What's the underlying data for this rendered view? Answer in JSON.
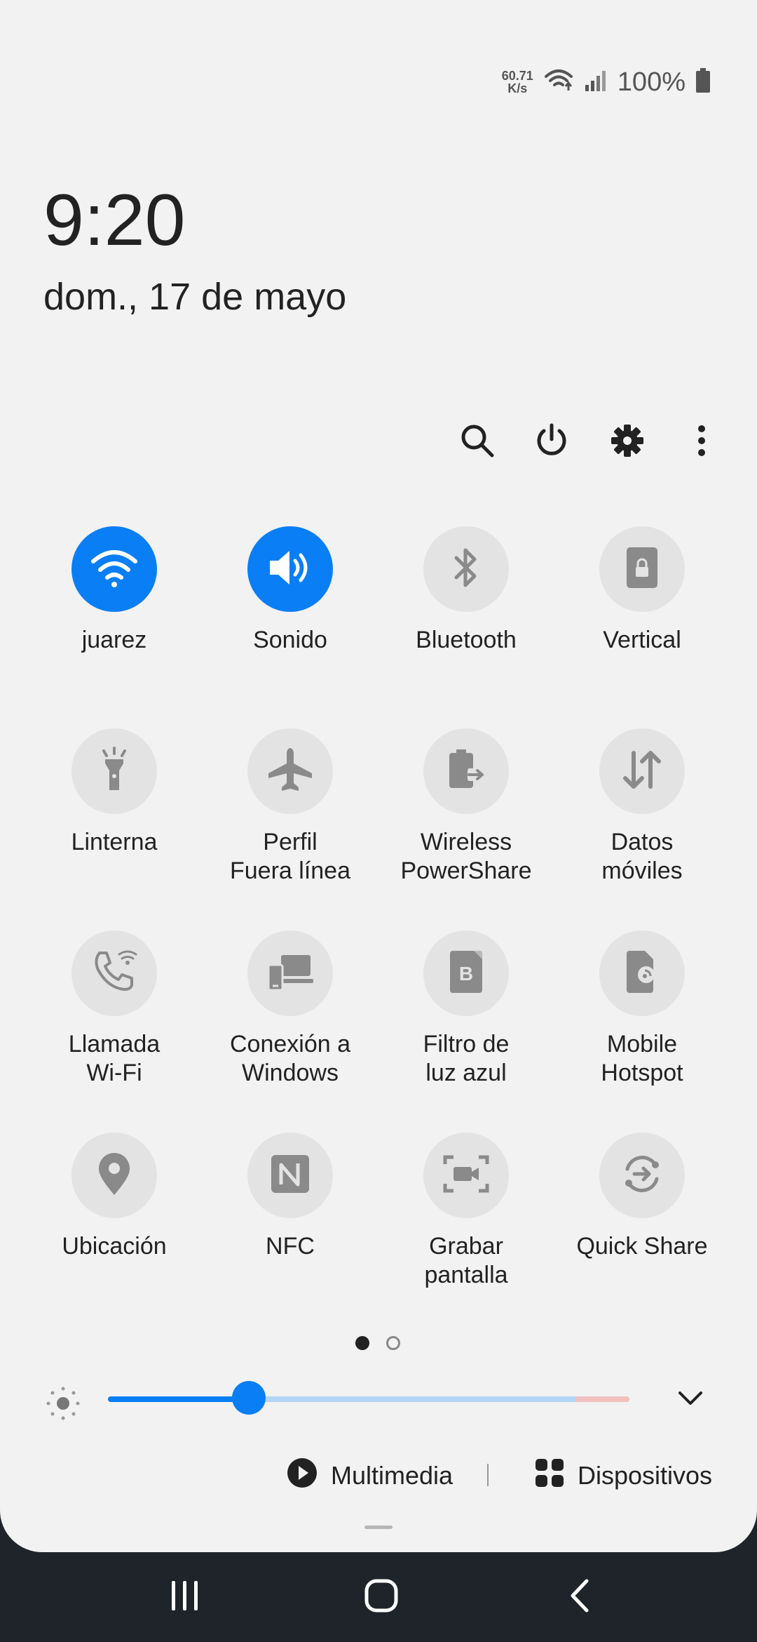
{
  "status_bar": {
    "speed_value": "60.71",
    "speed_unit": "K/s",
    "battery_percent": "100%"
  },
  "clock": {
    "time": "9:20",
    "date": "dom., 17 de mayo"
  },
  "toolbar": {
    "icons": [
      "search-icon",
      "power-icon",
      "gear-icon",
      "more-icon"
    ]
  },
  "tiles": [
    {
      "label": "juarez",
      "icon": "wifi-icon",
      "active": true
    },
    {
      "label": "Sonido",
      "icon": "sound-icon",
      "active": true
    },
    {
      "label": "Bluetooth",
      "icon": "bluetooth-icon",
      "active": false
    },
    {
      "label": "Vertical",
      "icon": "orientation-lock-icon",
      "active": false
    },
    {
      "label": "Linterna",
      "icon": "flashlight-icon",
      "active": false
    },
    {
      "label": "Perfil\nFuera línea",
      "icon": "airplane-icon",
      "active": false
    },
    {
      "label": "Wireless\nPowerShare",
      "icon": "powershare-icon",
      "active": false
    },
    {
      "label": "Datos\nmóviles",
      "icon": "mobile-data-icon",
      "active": false
    },
    {
      "label": "Llamada\nWi-Fi",
      "icon": "wifi-call-icon",
      "active": false
    },
    {
      "label": "Conexión a\nWindows",
      "icon": "link-windows-icon",
      "active": false
    },
    {
      "label": "Filtro de\nluz azul",
      "icon": "blue-light-filter-icon",
      "active": false
    },
    {
      "label": "Mobile\nHotspot",
      "icon": "hotspot-icon",
      "active": false
    },
    {
      "label": "Ubicación",
      "icon": "location-icon",
      "active": false
    },
    {
      "label": "NFC",
      "icon": "nfc-icon",
      "active": false
    },
    {
      "label": "Grabar\npantalla",
      "icon": "screen-record-icon",
      "active": false
    },
    {
      "label": "Quick Share",
      "icon": "quick-share-icon",
      "active": false
    }
  ],
  "pager": {
    "current_page": 1,
    "total_pages": 2
  },
  "brightness": {
    "level": 0.27,
    "icon": "sun-icon"
  },
  "bottom": {
    "media_label": "Multimedia",
    "devices_label": "Dispositivos"
  },
  "colors": {
    "accent": "#0a7ef5",
    "panel_bg": "#f2f2f2",
    "tile_off": "#e3e3e3",
    "nav_bg": "#1f242b"
  }
}
